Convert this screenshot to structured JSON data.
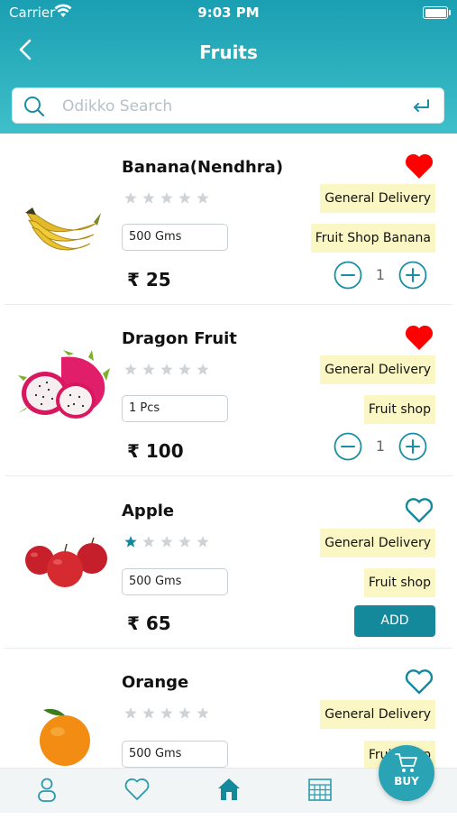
{
  "status_bar": {
    "carrier": "Carrier",
    "time": "9:03 PM"
  },
  "header": {
    "title": "Fruits"
  },
  "search": {
    "placeholder": "Odikko Search"
  },
  "currency": "₹",
  "products": [
    {
      "name": "Banana(Nendhra)",
      "rating": 0,
      "favorite": true,
      "quantity_unit": "500 Gms",
      "price": "₹ 25",
      "tags": [
        "General Delivery",
        "Fruit Shop Banana"
      ],
      "cart_qty": "1",
      "image": "banana-image"
    },
    {
      "name": "Dragon Fruit",
      "rating": 0,
      "favorite": true,
      "quantity_unit": "1 Pcs",
      "price": "₹ 100",
      "tags": [
        "General Delivery",
        "Fruit shop"
      ],
      "cart_qty": "1",
      "image": "dragon-fruit-image"
    },
    {
      "name": "Apple",
      "rating": 1,
      "favorite": false,
      "quantity_unit": "500 Gms",
      "price": "₹ 65",
      "tags": [
        "General Delivery",
        "Fruit shop"
      ],
      "add_label": "ADD",
      "image": "apple-image"
    },
    {
      "name": "Orange",
      "rating": 0,
      "favorite": false,
      "quantity_unit": "500 Gms",
      "tags": [
        "General Delivery",
        "Fruit shop"
      ],
      "image": "orange-image"
    }
  ],
  "buy_button": {
    "label": "BUY"
  },
  "tab_bar": {
    "tabs": [
      "profile-icon",
      "heart-icon",
      "home-icon",
      "calendar-icon"
    ],
    "active": "home-icon"
  },
  "colors": {
    "accent": "#15899c",
    "header_top": "#1a9fb2",
    "header_bottom": "#3fbfc9",
    "heart_filled": "#ff0000",
    "tag_bg": "#fbf7c4"
  }
}
